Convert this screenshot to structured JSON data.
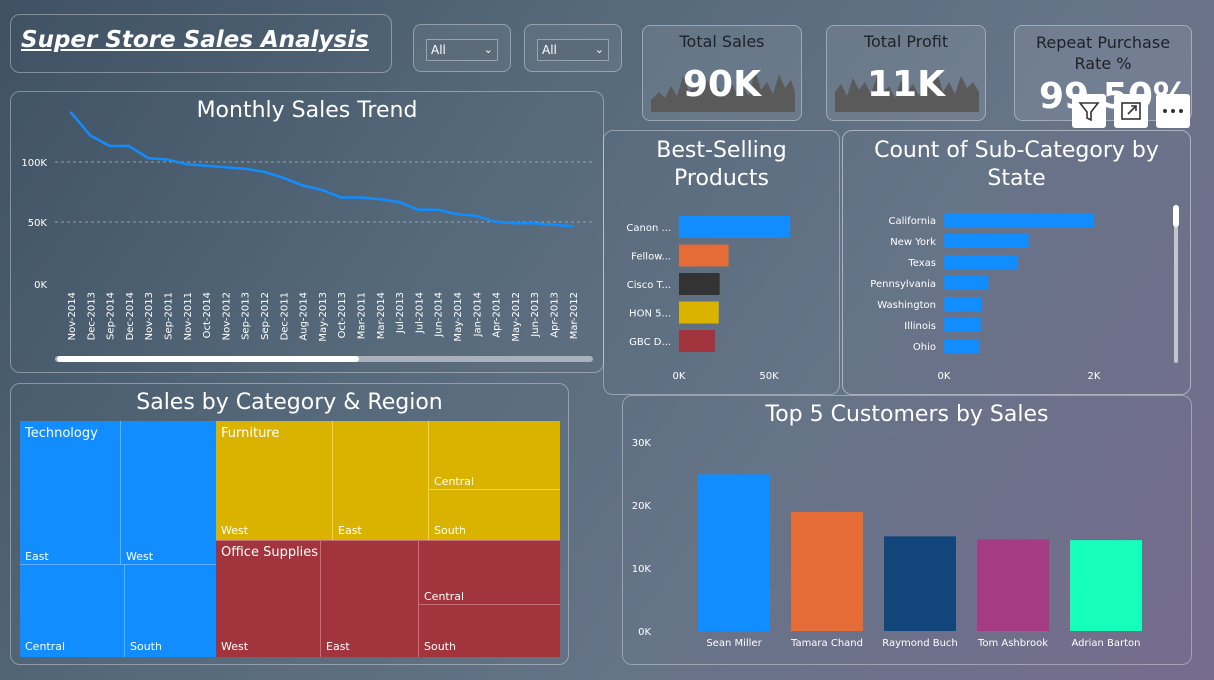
{
  "title": "Super Store Sales Analysis",
  "filters": [
    {
      "value": "All"
    },
    {
      "value": "All"
    }
  ],
  "kpis": [
    {
      "label": "Total Sales",
      "value": "90K"
    },
    {
      "label": "Total Profit",
      "value": "11K"
    },
    {
      "label": "Repeat Purchase Rate %",
      "value": "99.50%"
    }
  ],
  "monthly_trend": {
    "title": "Monthly Sales Trend",
    "y_ticks": [
      "100K",
      "50K",
      "0K"
    ]
  },
  "best_selling": {
    "title": "Best-Selling Products",
    "x_ticks": [
      "0K",
      "50K"
    ]
  },
  "subcat_state": {
    "title": "Count of Sub-Category by State",
    "x_ticks": [
      "0K",
      "2K"
    ]
  },
  "treemap": {
    "title": "Sales by Category & Region",
    "tech": {
      "name": "Technology",
      "east": "East",
      "west": "West",
      "central": "Central",
      "south": "South"
    },
    "furn": {
      "name": "Furniture",
      "west": "West",
      "east": "East",
      "central": "Central",
      "south": "South"
    },
    "office": {
      "name": "Office Supplies",
      "west": "West",
      "east": "East",
      "central": "Central",
      "south": "South"
    }
  },
  "top_customers": {
    "title": "Top 5 Customers by Sales",
    "y_ticks": [
      "30K",
      "20K",
      "10K",
      "0K"
    ]
  },
  "colors": {
    "accent": "#118dff",
    "orange": "#e66c37",
    "dark": "#333333",
    "gold": "#d9b300",
    "red": "#a1343c",
    "navy": "#12467b",
    "magenta": "#a43b83",
    "teal": "#15ffbb"
  },
  "chart_data": [
    {
      "type": "line",
      "title": "Monthly Sales Trend",
      "x": [
        "Nov-2014",
        "Dec-2013",
        "Sep-2014",
        "Dec-2014",
        "Nov-2013",
        "Sep-2011",
        "Nov-2011",
        "Oct-2014",
        "Nov-2012",
        "Sep-2013",
        "Sep-2012",
        "Dec-2011",
        "Aug-2014",
        "May-2013",
        "Oct-2013",
        "Mar-2011",
        "Mar-2014",
        "Jul-2013",
        "Jul-2014",
        "Jun-2014",
        "May-2014",
        "Jan-2014",
        "Apr-2014",
        "May-2012",
        "Jun-2013",
        "Apr-2013",
        "Mar-2012"
      ],
      "y": [
        113000,
        98000,
        91000,
        91000,
        83000,
        82000,
        79000,
        78000,
        77000,
        76000,
        74000,
        70000,
        65000,
        62000,
        57000,
        57000,
        56000,
        54000,
        49000,
        49000,
        46000,
        45000,
        41000,
        40000,
        40000,
        39000,
        38000
      ],
      "ylim": [
        0,
        120000
      ]
    },
    {
      "type": "bar",
      "title": "Best-Selling Products",
      "categories": [
        "Canon ...",
        "Fellow...",
        "Cisco T...",
        "HON 5...",
        "GBC D..."
      ],
      "values": [
        61600,
        27500,
        22600,
        22100,
        20000
      ],
      "xlim": [
        0,
        70000
      ]
    },
    {
      "type": "bar",
      "title": "Count of Sub-Category by State",
      "categories": [
        "California",
        "New York",
        "Texas",
        "Pennsylvania",
        "Washington",
        "Illinois",
        "Ohio"
      ],
      "values": [
        2000,
        1130,
        985,
        590,
        506,
        492,
        469
      ],
      "xlim": [
        0,
        2600
      ]
    },
    {
      "type": "bar",
      "title": "Top 5 Customers by Sales",
      "categories": [
        "Sean Miller",
        "Tamara Chand",
        "Raymond Buch",
        "Tom Ashbrook",
        "Adrian Barton"
      ],
      "values": [
        25000,
        19000,
        15100,
        14600,
        14500
      ],
      "ylim": [
        0,
        30000
      ]
    }
  ]
}
